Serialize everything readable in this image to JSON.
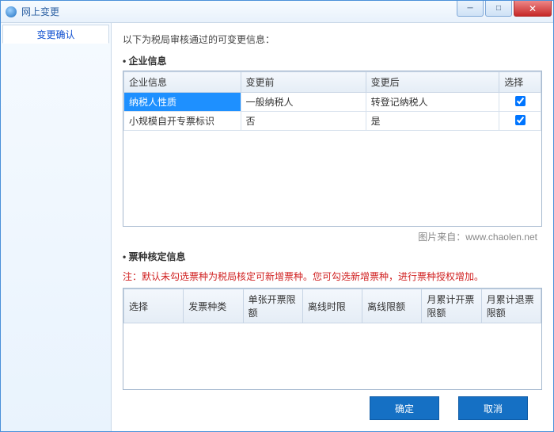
{
  "window": {
    "title": "网上变更"
  },
  "sidebar": {
    "tab": "变更确认"
  },
  "intro": "以下为税局审核通过的可变更信息：",
  "section1": {
    "title": "企业信息",
    "headers": [
      "企业信息",
      "变更前",
      "变更后",
      "选择"
    ],
    "rows": [
      {
        "c0": "纳税人性质",
        "c1": "一般纳税人",
        "c2": "转登记纳税人",
        "checked": true,
        "selected": true
      },
      {
        "c0": "小规模自开专票标识",
        "c1": "否",
        "c2": "是",
        "checked": true,
        "selected": false
      }
    ]
  },
  "watermark": "图片来自：www.chaolen.net",
  "section2": {
    "title": "票种核定信息",
    "note": "注：默认未勾选票种为税局核定可新增票种。您可勾选新增票种，进行票种授权增加。",
    "headers": [
      "选择",
      "发票种类",
      "单张开票限额",
      "离线时限",
      "离线限额",
      "月累计开票限额",
      "月累计退票限额"
    ]
  },
  "buttons": {
    "ok": "确定",
    "cancel": "取消"
  }
}
